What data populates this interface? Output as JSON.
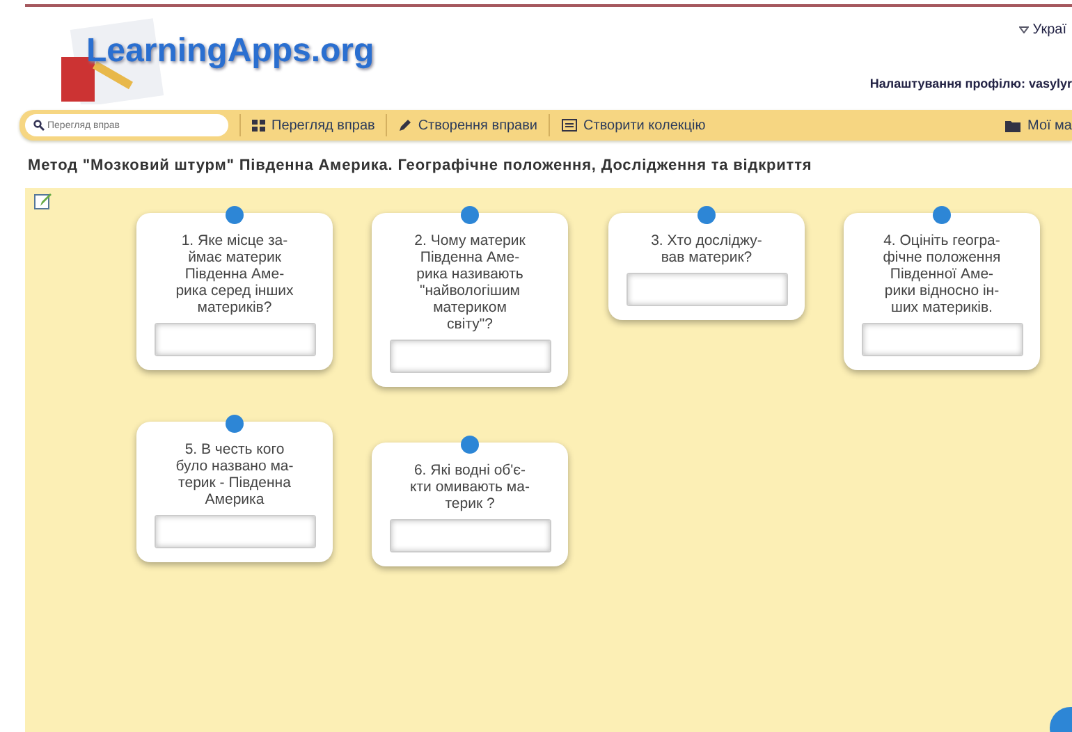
{
  "header": {
    "logo": "LearningApps.org",
    "language": "Украї",
    "profile": "Налаштування профілю: vasylyr"
  },
  "nav": {
    "search": {
      "placeholder": "Перегляд вправ"
    },
    "links": [
      {
        "label": "Перегляд вправ",
        "kind": "grid"
      },
      {
        "label": "Створення вправи",
        "kind": "pencil"
      },
      {
        "label": "Створити колекцію",
        "kind": "collection"
      }
    ],
    "right_link": {
      "label": "Мої ма",
      "kind": "folder"
    }
  },
  "title": "Метод \"Мозковий штурм\" Південна Америка. Географічне положення, Дослідження та відкриття",
  "cards": [
    {
      "lines": [
        "1. Яке місце за-",
        "ймає материк",
        "Південна Аме-",
        "рика серед інших",
        "материків?"
      ]
    },
    {
      "lines": [
        "2. Чому материк",
        "Південна Аме-",
        "рика називають",
        "\"найвологішим",
        "материком",
        "світу\"?"
      ]
    },
    {
      "lines": [
        "3. Хто досліджу-",
        "вав материк?"
      ]
    },
    {
      "lines": [
        "4. Оцініть геогра-",
        "фічне положення",
        "Південної Аме-",
        "рики відносно ін-",
        "ших материків."
      ]
    },
    {
      "lines": [
        "5. В честь кого",
        "було названо ма-",
        "терик - Південна",
        "Америка"
      ]
    },
    {
      "lines": [
        "6. Які водні об'є-",
        "кти омивають ма-",
        "терик ?"
      ]
    }
  ]
}
